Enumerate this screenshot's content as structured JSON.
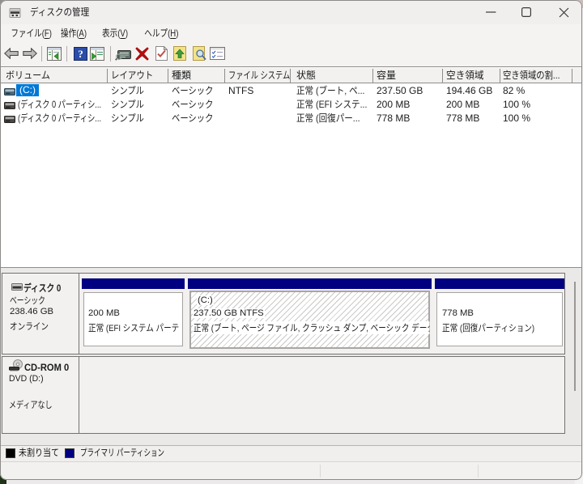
{
  "window": {
    "title": "ディスクの管理"
  },
  "menu_bar": {
    "items": [
      {
        "pre": "ファイル(",
        "key": "F",
        "post": ")"
      },
      {
        "pre": "操作(",
        "key": "A",
        "post": ")"
      },
      {
        "pre": "表示(",
        "key": "V",
        "post": ")"
      },
      {
        "pre": "ヘルプ(",
        "key": "H",
        "post": ")"
      }
    ]
  },
  "toolbar": {
    "icons": [
      "back",
      "forward",
      "show-console-tree",
      "help",
      "show-action-pane",
      "properties",
      "delete",
      "document-check",
      "folder-up",
      "document-search",
      "checklist"
    ]
  },
  "volume_list": {
    "columns": [
      "ボリューム",
      "レイアウト",
      "種類",
      "ファイル システム",
      "状態",
      "容量",
      "空き領域",
      "空き領域の割..."
    ],
    "rows": [
      {
        "volume": "(C:)",
        "layout": "シンプル",
        "type": "ベーシック",
        "fs": "NTFS",
        "status": "正常 (ブート, ペ...",
        "capacity": "237.50 GB",
        "free": "194.46 GB",
        "pct": "82 %"
      },
      {
        "volume": "(ディスク 0 パーティシ...",
        "layout": "シンプル",
        "type": "ベーシック",
        "fs": "",
        "status": "正常 (EFI システ...",
        "capacity": "200 MB",
        "free": "200 MB",
        "pct": "100 %"
      },
      {
        "volume": "(ディスク 0 パーティシ...",
        "layout": "シンプル",
        "type": "ベーシック",
        "fs": "",
        "status": "正常 (回復パー...",
        "capacity": "778 MB",
        "free": "778 MB",
        "pct": "100 %"
      }
    ]
  },
  "graphical_view": {
    "disk0": {
      "name": "ディスク 0",
      "type": "ベーシック",
      "size": "238.46 GB",
      "status": "オンライン",
      "partitions": [
        {
          "size_line": "200 MB",
          "status_line": "正常 (EFI システム パーテ"
        },
        {
          "label": "(C:)",
          "size_line": "237.50 GB NTFS",
          "status_line": "正常 (ブート, ページ ファイル, クラッシュ ダンプ, ベーシック データ"
        },
        {
          "size_line": "778 MB",
          "status_line": "正常 (回復パーティション)"
        }
      ]
    },
    "cdrom": {
      "name": "CD-ROM 0",
      "drive": "DVD (D:)",
      "media": "メディアなし"
    }
  },
  "legend": {
    "items": [
      {
        "label": "未割り当て",
        "color": "#000000"
      },
      {
        "label": "プライマリ パーティション",
        "color": "#000080"
      }
    ]
  },
  "colors": {
    "selection": "#0078d7",
    "partition_bar": "#000080",
    "window_chrome": "#f1efee"
  }
}
